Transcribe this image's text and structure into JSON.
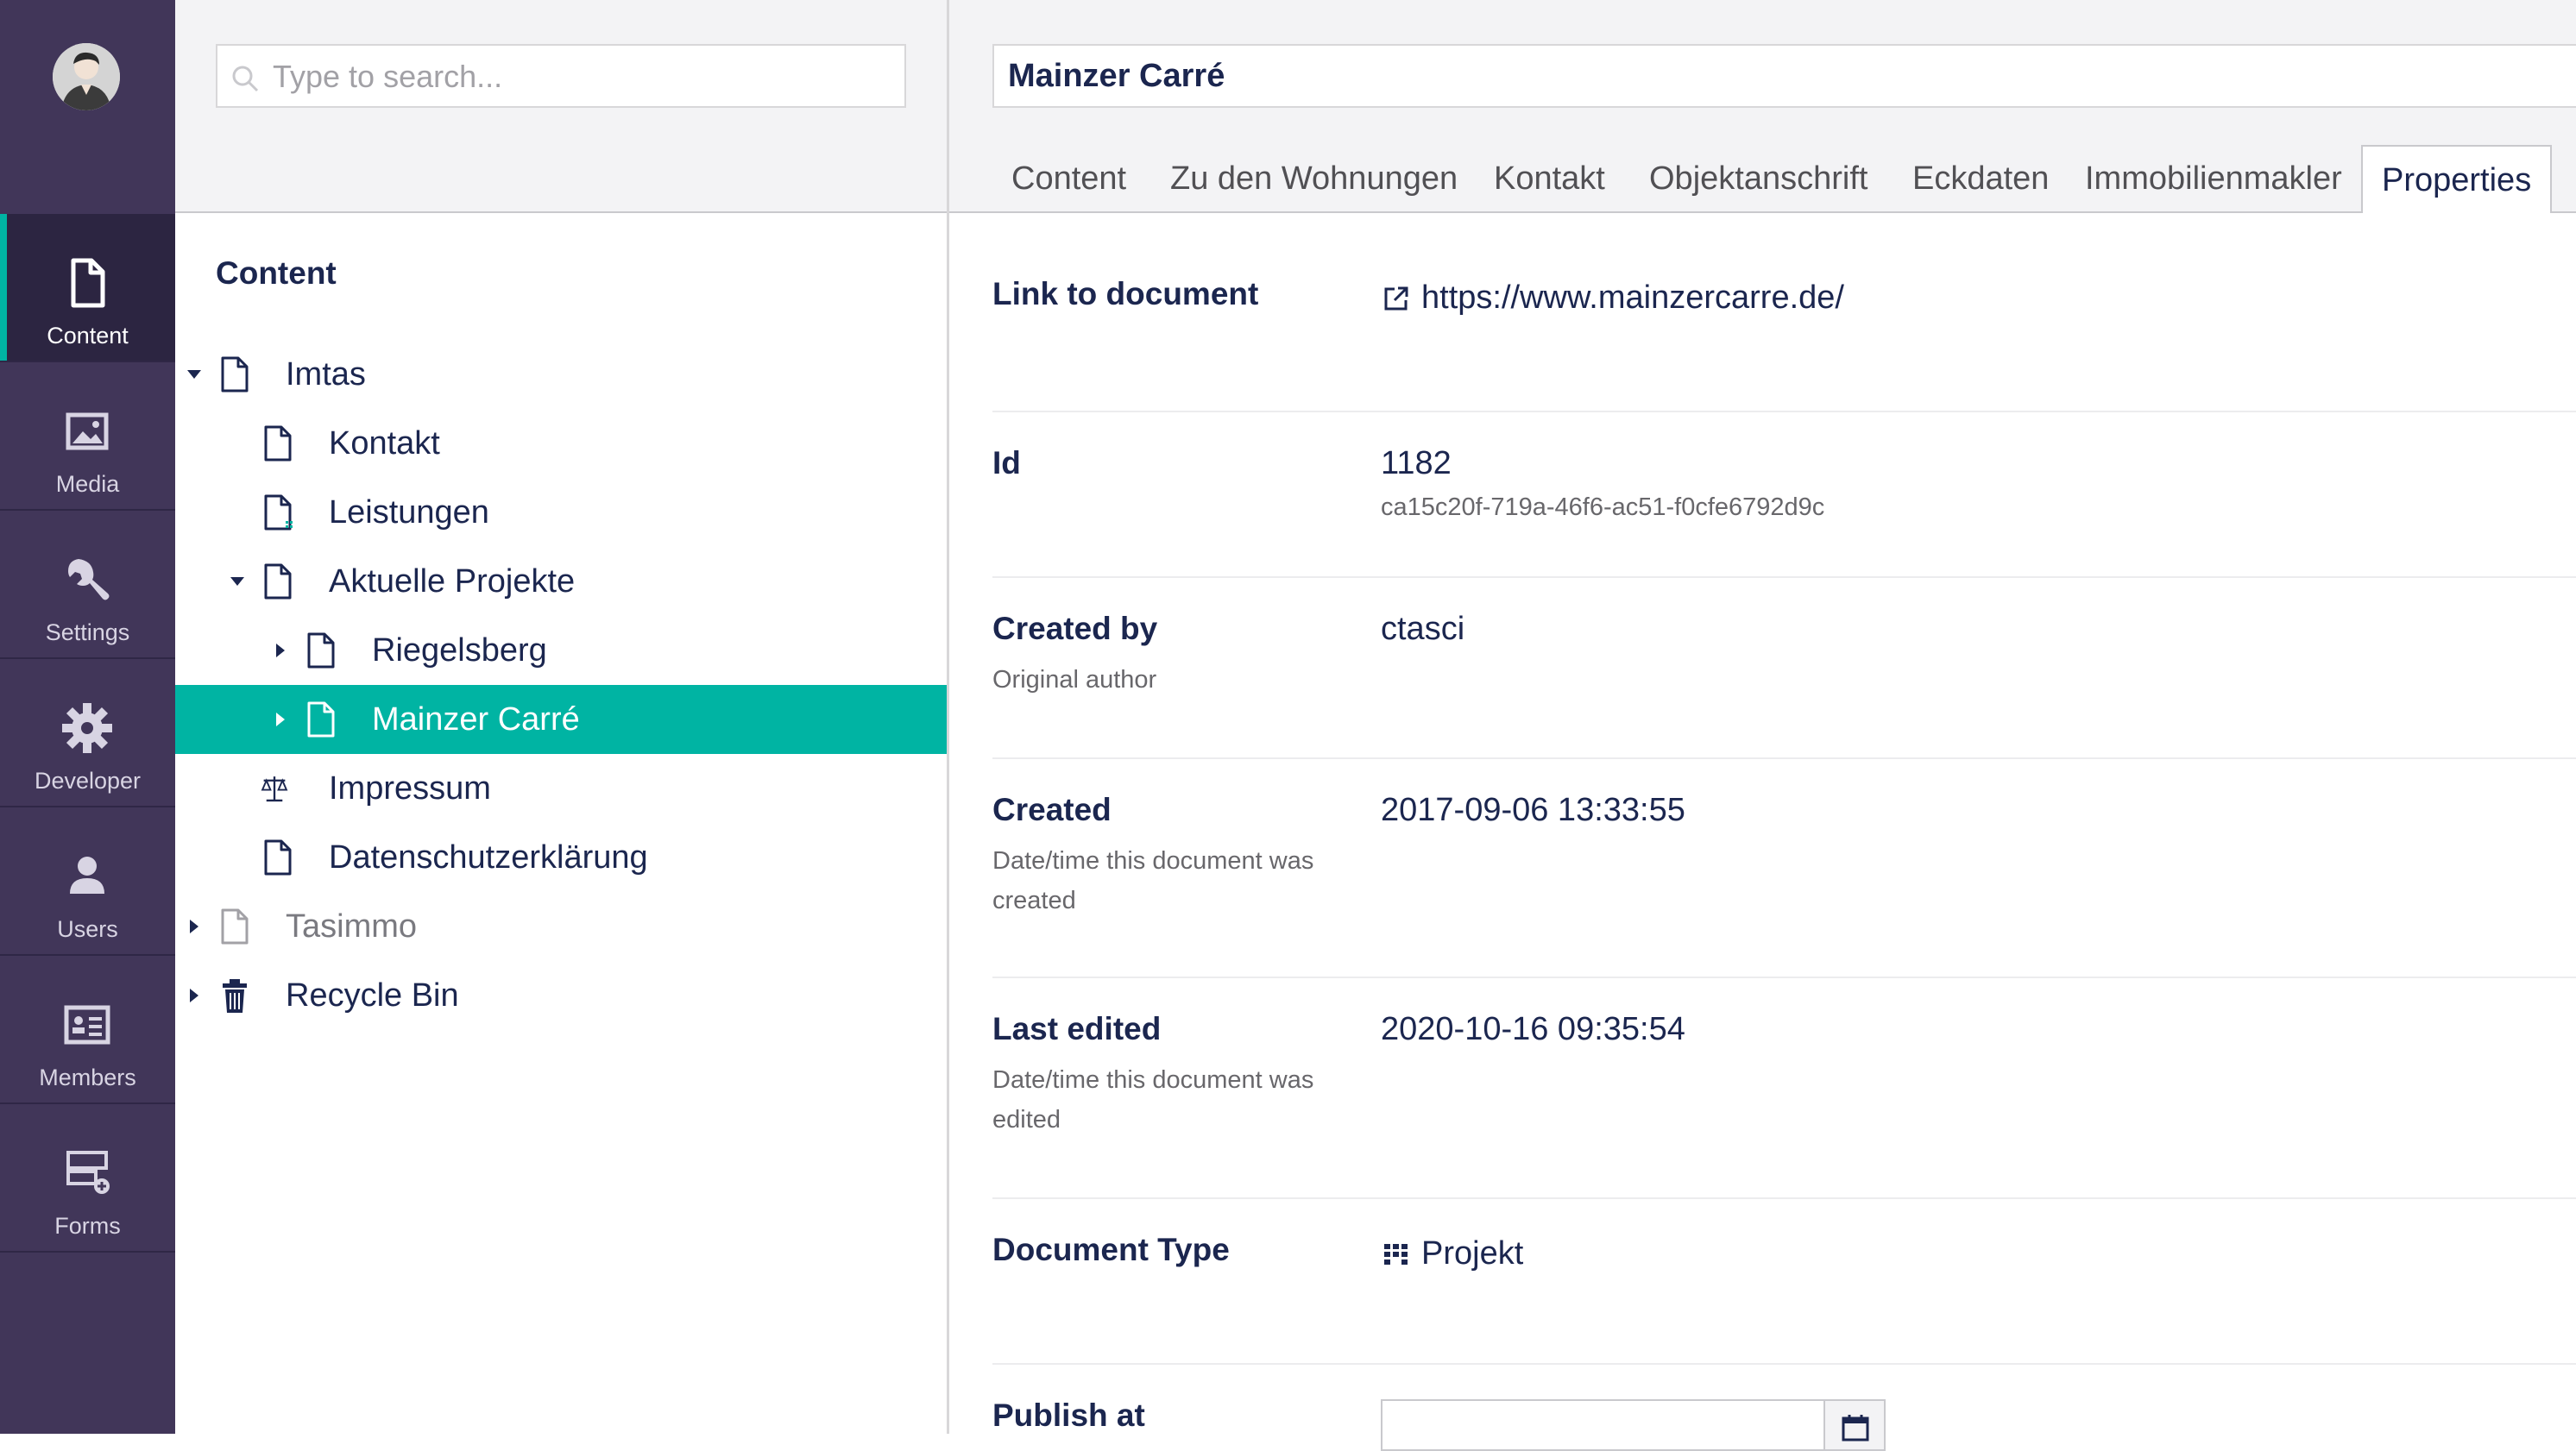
{
  "sidebar": {
    "sections": [
      {
        "label": "Content",
        "icon": "document-icon",
        "active": true
      },
      {
        "label": "Media",
        "icon": "image-icon"
      },
      {
        "label": "Settings",
        "icon": "wrench-icon"
      },
      {
        "label": "Developer",
        "icon": "gear-icon"
      },
      {
        "label": "Users",
        "icon": "user-icon"
      },
      {
        "label": "Members",
        "icon": "id-card-icon"
      },
      {
        "label": "Forms",
        "icon": "form-add-icon"
      }
    ]
  },
  "tree": {
    "search_placeholder": "Type to search...",
    "title": "Content",
    "nodes": [
      {
        "label": "Imtas",
        "expanded": true
      },
      {
        "label": "Kontakt"
      },
      {
        "label": "Leistungen"
      },
      {
        "label": "Aktuelle Projekte",
        "expanded": true
      },
      {
        "label": "Riegelsberg"
      },
      {
        "label": "Mainzer Carré",
        "selected": true
      },
      {
        "label": "Impressum"
      },
      {
        "label": "Datenschutzerklärung"
      },
      {
        "label": "Tasimmo"
      },
      {
        "label": "Recycle Bin"
      }
    ]
  },
  "editor": {
    "document_name": "Mainzer Carré",
    "tabs": [
      "Content",
      "Zu den Wohnungen",
      "Kontakt",
      "Objektanschrift",
      "Eckdaten",
      "Immobilienmakler",
      "Properties"
    ],
    "active_tab": "Properties",
    "properties": {
      "link": {
        "label": "Link to document",
        "value": "https://www.mainzercarre.de/"
      },
      "id": {
        "label": "Id",
        "value": "1182",
        "guid": "ca15c20f-719a-46f6-ac51-f0cfe6792d9c"
      },
      "created_by": {
        "label": "Created by",
        "description": "Original author",
        "value": "ctasci"
      },
      "created": {
        "label": "Created",
        "description": "Date/time this document was created",
        "value": "2017-09-06 13:33:55"
      },
      "last_edited": {
        "label": "Last edited",
        "description": "Date/time this document was edited",
        "value": "2020-10-16 09:35:54"
      },
      "document_type": {
        "label": "Document Type",
        "value": "Projekt"
      },
      "publish_at": {
        "label": "Publish at",
        "value": ""
      }
    }
  },
  "colors": {
    "sidebar_bg": "#413659",
    "accent": "#00b4a3",
    "text_primary": "#1b264f",
    "text_muted": "#68676b"
  }
}
